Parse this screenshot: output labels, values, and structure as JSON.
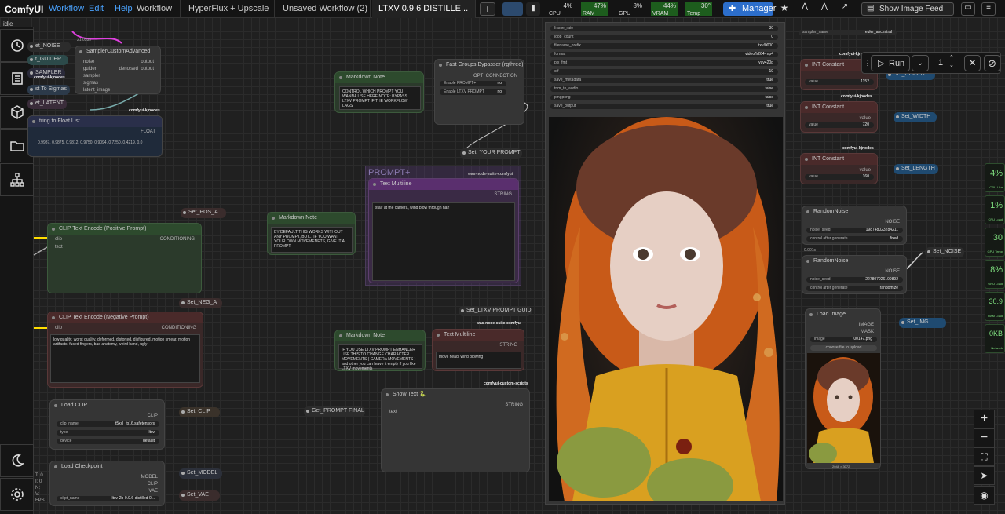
{
  "app": {
    "name": "ComfyUI",
    "status": "idle",
    "menu": [
      "Workflow",
      "Edit",
      "Help"
    ],
    "tabs": [
      "Workflow",
      "HyperFlux + Upscale",
      "Unsaved Workflow (2)",
      "LTXV 0.9.6 DISTILLE..."
    ]
  },
  "monitors": {
    "cpu": {
      "label": "CPU",
      "value": "4%"
    },
    "ram": {
      "label": "RAM",
      "value": "47%"
    },
    "gpu": {
      "label": "GPU",
      "value": "8%"
    },
    "vram": {
      "label": "VRAM",
      "value": "44%"
    },
    "temp": {
      "label": "Temp",
      "value": "30°"
    }
  },
  "buttons": {
    "manager": "Manager",
    "show_image_feed": "Show Image Feed",
    "run": "Run",
    "queue_count": "1"
  },
  "side_monitors": [
    {
      "value": "4%",
      "label": "CPU Usa"
    },
    {
      "value": "1%",
      "label": "CPU Load"
    },
    {
      "value": "30",
      "label": "GPU Temp"
    },
    {
      "value": "8%",
      "label": "GPU Load"
    },
    {
      "value": "30.9",
      "label": "RAM Load"
    },
    {
      "value": "0KB",
      "label": "Network"
    }
  ],
  "nodes": {
    "sampler": {
      "title": "SamplerCustomAdvanced",
      "badge": "21.053s",
      "inputs": [
        "noise",
        "guider",
        "sampler",
        "sigmas",
        "latent_image"
      ],
      "outputs": [
        "output",
        "denoised_output"
      ]
    },
    "set_noise_top": "et_NOISE",
    "guider": "t_GUIDER",
    "sampler_label": "SAMPLER",
    "sigmas": "st To Sigmas",
    "latent": "et_LATENT",
    "kjnodes1": "comfyui-kjnodes",
    "kjnodes2": "comfyui-kjnodes",
    "str_float": {
      "title": "tring to Float List",
      "output": "FLOAT",
      "text": "0.9937, 0.9875, 0.9812, 0.9750, 0.9094, 0.7250, 0.4219, 0.0"
    },
    "clip_pos": {
      "title": "CLIP Text Encode (Positive Prompt)",
      "inputs": [
        "clip",
        "text"
      ],
      "output": "CONDITIONING",
      "setter": "Set_POS_A"
    },
    "clip_neg": {
      "title": "CLIP Text Encode (Negative Prompt)",
      "input": "clip",
      "output": "CONDITIONING",
      "setter": "Set_NEG_A",
      "text": "low quality, worst quality, deformed, distorted, disfigured, motion smear, motion artifacts, fused fingers, bad anatomy, weird hand, ugly"
    },
    "load_clip": {
      "title": "Load CLIP",
      "output": "CLIP",
      "setter": "Set_CLIP",
      "widgets": [
        {
          "name": "clip_name",
          "value": "t5xxl_fp16.safetensors"
        },
        {
          "name": "type",
          "value": "ltxv"
        },
        {
          "name": "device",
          "value": "default"
        }
      ]
    },
    "load_ckpt": {
      "title": "Load Checkpoint",
      "outputs": [
        "MODEL",
        "CLIP",
        "VAE"
      ],
      "setters": [
        "Set_MODEL",
        "Set_VAE"
      ],
      "widget": {
        "name": "ckpt_name",
        "value": "ltxv-2b-0.9.6-distilled-0..."
      }
    },
    "md1": {
      "title": "Markdown Note",
      "text": "CONTROL WHICH PROMPT YOU WANNA USE HERE NOTE: BYPASS LTXV PROMPT IF THE WORKFLOW LAGS"
    },
    "md2": {
      "title": "Markdown Note",
      "text": "BY DEFAULT THIS WORKS WITHOUT ANY PROMPT, BUT... IF YOU WANT YOUR OWN MOVEMENETS, GIVE IT A PROMPT"
    },
    "md3": {
      "title": "Markdown Note",
      "text": "IF YOU USE LTXV PROMPT ENHANCER USE THIS TO CHANGE CHARACTER MOVEMENTS ( CAMERA MOVEMENTS ) and other you can leave it empty if you like LTXV movements"
    },
    "bypasser": {
      "title": "Fast Groups Bypasser (rgthree)",
      "output": "OPT_CONNECTION",
      "toggles": [
        {
          "name": "Enable PROMPT+",
          "value": "no"
        },
        {
          "name": "Enable LTXV PROMPT",
          "value": "no"
        }
      ]
    },
    "set_your_prompt": "Set_YOUR PROMPT",
    "group_prompt": "PROMPT+",
    "was1": "was-node-suite-comfyui",
    "text_multi1": {
      "title": "Text Multiline",
      "output": "STRING",
      "text": "stair at the camera, wind blow through hair"
    },
    "set_ltxv_guid": "Set_LTXV PROMPT GUID",
    "was2": "was-node-suite-comfyui",
    "text_multi2": {
      "title": "Text Multiline",
      "output": "STRING",
      "text": "move head, wind blowing"
    },
    "custom_scripts": "comfyui-custom-scripts",
    "show_text": {
      "title": "Show Text 🐍",
      "input": "text",
      "output": "STRING"
    },
    "get_prompt_final": "Get_PROMPT FINAL",
    "video_widgets": [
      {
        "name": "frame_rate",
        "value": "30"
      },
      {
        "name": "loop_count",
        "value": "0"
      },
      {
        "name": "filename_prefix",
        "value": "ltxv/0000"
      },
      {
        "name": "format",
        "value": "video/h264-mp4"
      },
      {
        "name": "pix_fmt",
        "value": "yuv420p"
      },
      {
        "name": "crf",
        "value": "19"
      },
      {
        "name": "save_metadata",
        "value": "true"
      },
      {
        "name": "trim_to_audio",
        "value": "false"
      },
      {
        "name": "pingpong",
        "value": "false"
      },
      {
        "name": "save_output",
        "value": "true"
      }
    ],
    "sampler_name": {
      "name": "sampler_name",
      "value": "euler_ancestral"
    },
    "int1": {
      "title": "INT Constant",
      "output": "value",
      "widget": {
        "name": "value",
        "value": "1152"
      },
      "setter": "Set_HEIGHT"
    },
    "int2": {
      "title": "INT Constant",
      "output": "value",
      "widget": {
        "name": "value",
        "value": "720"
      },
      "setter": "Set_WIDTH"
    },
    "int3": {
      "title": "INT Constant",
      "output": "value",
      "widget": {
        "name": "value",
        "value": "160"
      },
      "setter": "Set_LENGTH"
    },
    "kj_a": "comfyui-kjnodes",
    "kj_b": "comfyui-kjnodes",
    "kj_c": "comfyui-kjnodes",
    "rn1": {
      "title": "RandomNoise",
      "output": "NOISE",
      "seed": {
        "name": "noise_seed",
        "value": "198748023284211"
      },
      "ctrl": {
        "name": "control after generate",
        "value": "fixed"
      }
    },
    "rn_time": "0.001s",
    "rn2": {
      "title": "RandomNoise",
      "output": "NOISE",
      "seed": {
        "name": "noise_seed",
        "value": "227807926199892"
      },
      "ctrl": {
        "name": "control after generate",
        "value": "randomize"
      }
    },
    "set_noise2": "Set_NOISE",
    "load_image": {
      "title": "Load Image",
      "outputs": [
        "IMAGE",
        "MASK"
      ],
      "widget": {
        "name": "image",
        "value": "00147.png"
      },
      "upload": "choose file to upload",
      "size": "2048 × 3072",
      "setter": "Set_IMG"
    },
    "bottom_left": [
      "T: 0",
      "I: 0",
      "N:",
      "V:",
      "FPS"
    ]
  },
  "colors": {
    "accent": "#2c6ecb",
    "green_monitor": "#2e8b2e"
  }
}
